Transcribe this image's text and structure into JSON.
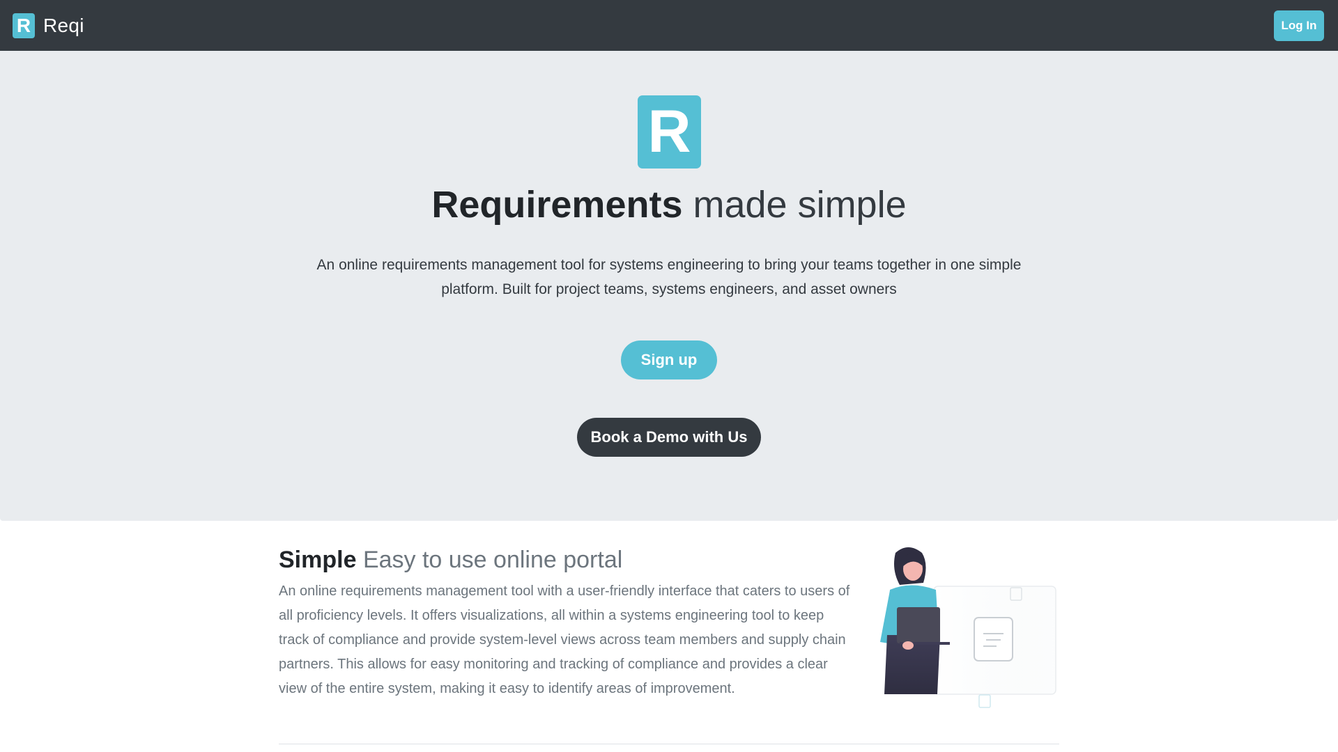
{
  "navbar": {
    "logo_letter": "R",
    "brand_name": "Reqi",
    "login_label": "Log In"
  },
  "hero": {
    "logo_letter": "R",
    "title_strong": "Requirements",
    "title_light": "made simple",
    "description": "An online requirements management tool for systems engineering to bring your teams together in one simple platform. Built for project teams, systems engineers, and asset owners",
    "signup_label": "Sign up",
    "demo_label": "Book a Demo with Us"
  },
  "feature": {
    "title_strong": "Simple",
    "title_accent": "Easy to use online portal",
    "text": "An online requirements management tool with a user-friendly interface that caters to users of all proficiency levels. It offers visualizations, all within a systems engineering tool to keep track of compliance and provide system-level views across team members and supply chain partners. This allows for easy monitoring and tracking of compliance and provides a clear view of the entire system, making it easy to identify areas of improvement."
  },
  "colors": {
    "accent": "#55bfd4",
    "navbar": "#343a40",
    "hero_bg": "#e9ecef"
  }
}
